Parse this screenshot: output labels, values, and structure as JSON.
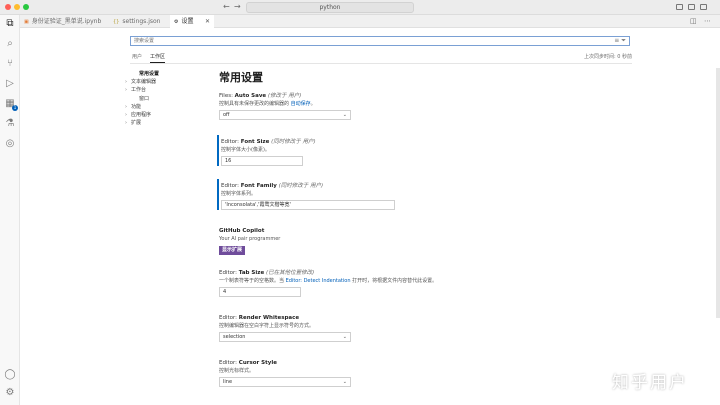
{
  "titlebar": {
    "title": "python",
    "back": "←",
    "forward": "→"
  },
  "tabs": [
    {
      "label": "身份证验证_黑单说.ipynb",
      "icon": "▣"
    },
    {
      "label": "settings.json",
      "icon": "{}"
    },
    {
      "label": "设置",
      "icon": "⚙",
      "close": "✕"
    }
  ],
  "activity_icons": [
    "files-icon",
    "search-icon",
    "source-control-icon",
    "run-debug-icon",
    "extensions-icon",
    "testing-icon",
    "remote-icon"
  ],
  "activity_glyphs": {
    "files": "⧉",
    "search": "⌕",
    "scm": "⑂",
    "run": "▷",
    "extensions": "▦",
    "testing": "⚗",
    "remote": "◎",
    "account": "◯",
    "manage": "⚙",
    "badge": "1"
  },
  "search": {
    "placeholder": "搜索设置",
    "value": "",
    "clear_icon": "≡",
    "filter_icon": "⏷"
  },
  "scope": {
    "user": "用户",
    "workspace": "工作区",
    "sync_status": "上次同步时间: 0 秒前"
  },
  "toc": [
    {
      "label": "常用设置",
      "active": true,
      "chevron": ""
    },
    {
      "label": "文本编辑器",
      "chevron": "›"
    },
    {
      "label": "工作台",
      "chevron": "›"
    },
    {
      "label": "窗口",
      "chevron": ""
    },
    {
      "label": "功能",
      "chevron": "›"
    },
    {
      "label": "应用程序",
      "chevron": "›"
    },
    {
      "label": "扩展",
      "chevron": "›"
    }
  ],
  "section_title": "常用设置",
  "settings": {
    "auto_save": {
      "category": "Files: ",
      "name": "Auto Save",
      "note": "(修改于 用户)",
      "desc_prefix": "控制具有未保存更改的编辑器的 ",
      "desc_link": "自动保存",
      "desc_suffix": "。",
      "value": "off",
      "chevron": "⌄"
    },
    "font_size": {
      "category": "Editor: ",
      "name": "Font Size",
      "note": "(同时修改于 用户)",
      "desc": "控制字体大小(像素)。",
      "value": "16"
    },
    "font_family": {
      "category": "Editor: ",
      "name": "Font Family",
      "note": "(同时修改于 用户)",
      "desc": "控制字体系列。",
      "value": "'Inconsolata','霞鹜文楷等宽'"
    },
    "copilot": {
      "title": "GitHub Copilot",
      "desc": "Your AI pair programmer",
      "button": "显示扩展"
    },
    "tab_size": {
      "category": "Editor: ",
      "name": "Tab Size",
      "note": "(已在其他位置修改)",
      "desc_prefix": "一个制表符等于的空格数。当 ",
      "desc_link": "Editor: Detect Indentation",
      "desc_suffix": " 打开时，将根据文件内容替代此设置。",
      "value": "4"
    },
    "render_whitespace": {
      "category": "Editor: ",
      "name": "Render Whitespace",
      "desc": "控制编辑器在空白字符上显示符号的方式。",
      "value": "selection",
      "chevron": "⌄"
    },
    "cursor_style": {
      "category": "Editor: ",
      "name": "Cursor Style",
      "desc": "控制光标样式。",
      "value": "line",
      "chevron": "⌄"
    }
  },
  "watermark": "知乎用户"
}
